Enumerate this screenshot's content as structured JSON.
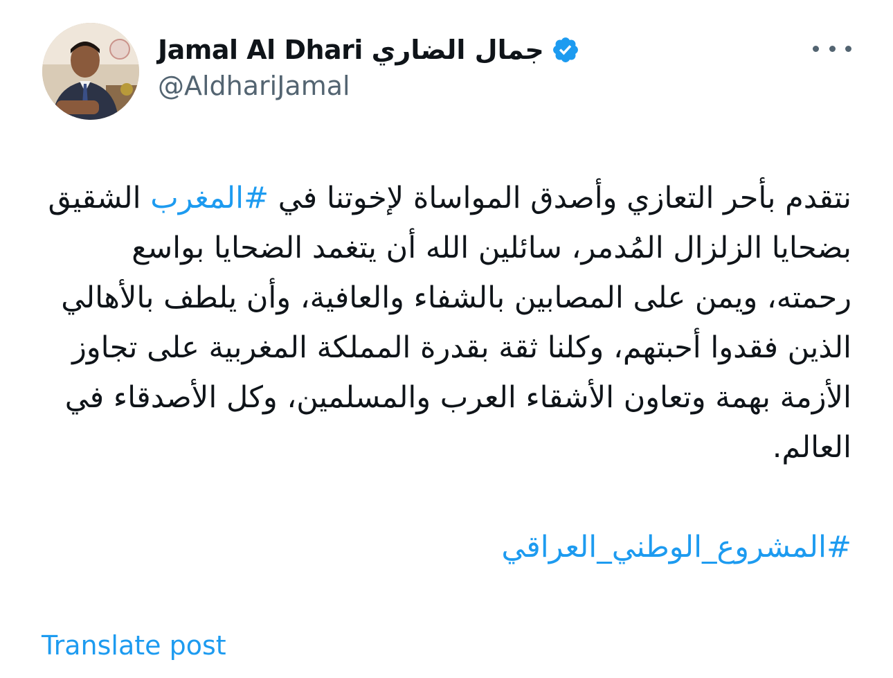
{
  "author": {
    "display_name": "Jamal Al Dhari جمال الضاري",
    "handle": "@AldhariJamal",
    "verified": true,
    "avatar_icon": "user-avatar-photo"
  },
  "post": {
    "text_before_hashtag": "نتقدم بأحر التعازي وأصدق المواساة لإخوتنا في ",
    "hashtag_inline": "#المغرب",
    "text_after_hashtag": " الشقيق بضحايا الزلزال المُدمر، سائلين الله أن يتغمد الضحايا بواسع رحمته، ويمن على المصابين بالشفاء والعافية، وأن يلطف بالأهالي الذين فقدوا أحبتهم، وكلنا ثقة بقدرة المملكة المغربية على تجاوز الأزمة بهمة وتعاون الأشقاء العرب والمسلمين، وكل الأصدقاء في العالم.",
    "hashtag_footer": "#المشروع_الوطني_العراقي"
  },
  "actions": {
    "translate_label": "Translate post",
    "more_icon": "more-horizontal-icon"
  },
  "colors": {
    "link": "#1d9bf0",
    "text": "#0f1419",
    "secondary": "#536471"
  }
}
